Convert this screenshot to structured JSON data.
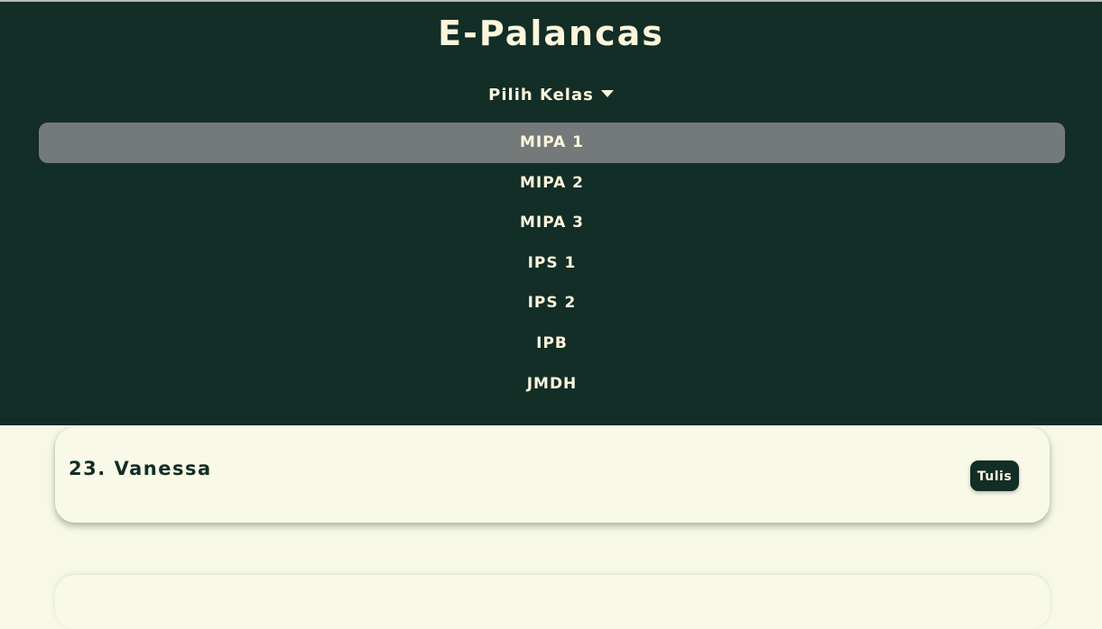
{
  "app": {
    "title": "E-Palancas"
  },
  "class_selector": {
    "label": "Pilih Kelas",
    "options": [
      "MIPA 1",
      "MIPA 2",
      "MIPA 3",
      "IPS 1",
      "IPS 2",
      "IPB",
      "JMDH"
    ],
    "highlighted": "MIPA 1"
  },
  "students": [
    {
      "number_name": "23. Vanessa",
      "action_label": "Tulis"
    }
  ],
  "colors": {
    "header_bg": "#132d27",
    "page_bg": "#f7f9e6",
    "text_light": "#fbf6dc",
    "highlight": "#747a7a"
  }
}
